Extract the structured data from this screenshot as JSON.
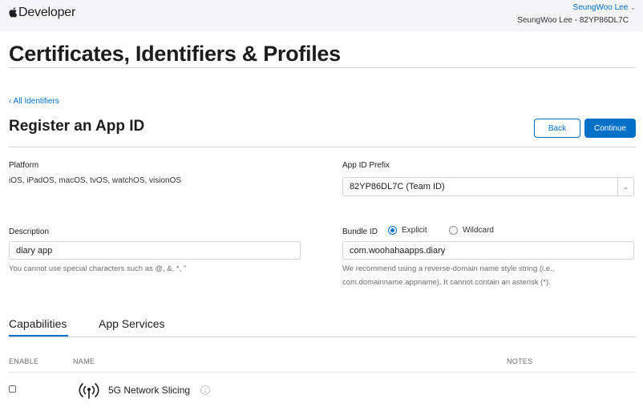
{
  "header": {
    "logo_text": "Developer",
    "user_name": "SeungWoo Lee",
    "team_line": "SeungWoo Lee - 82YP86DL7C"
  },
  "page": {
    "title": "Certificates, Identifiers & Profiles",
    "back_link": "‹ All Identifiers",
    "section_title": "Register an App ID",
    "back_button": "Back",
    "continue_button": "Continue"
  },
  "form": {
    "platform_label": "Platform",
    "platform_value": "iOS, iPadOS, macOS, tvOS, watchOS, visionOS",
    "prefix_label": "App ID Prefix",
    "prefix_value": "82YP86DL7C (Team ID)",
    "description_label": "Description",
    "description_value": "diary app",
    "description_hint": "You cannot use special characters such as @, &, *, \"",
    "bundle_label": "Bundle ID",
    "bundle_options": [
      "Explicit",
      "Wildcard"
    ],
    "bundle_selected": "Explicit",
    "bundle_value": "com.woohahaapps.diary",
    "bundle_hint_1": "We recommend using a reverse-domain name style string (i.e.,",
    "bundle_hint_2": "com.domainname.appname). It cannot contain an asterisk (*)."
  },
  "tabs": [
    {
      "label": "Capabilities",
      "active": true
    },
    {
      "label": "App Services",
      "active": false
    }
  ],
  "table": {
    "columns": [
      "ENABLE",
      "NAME",
      "NOTES"
    ],
    "rows": [
      {
        "enabled": false,
        "name": "5G Network Slicing",
        "icon": "antenna-icon"
      }
    ]
  },
  "colors": {
    "accent": "#0070c9",
    "topbar_bg": "#f5f5f7"
  }
}
